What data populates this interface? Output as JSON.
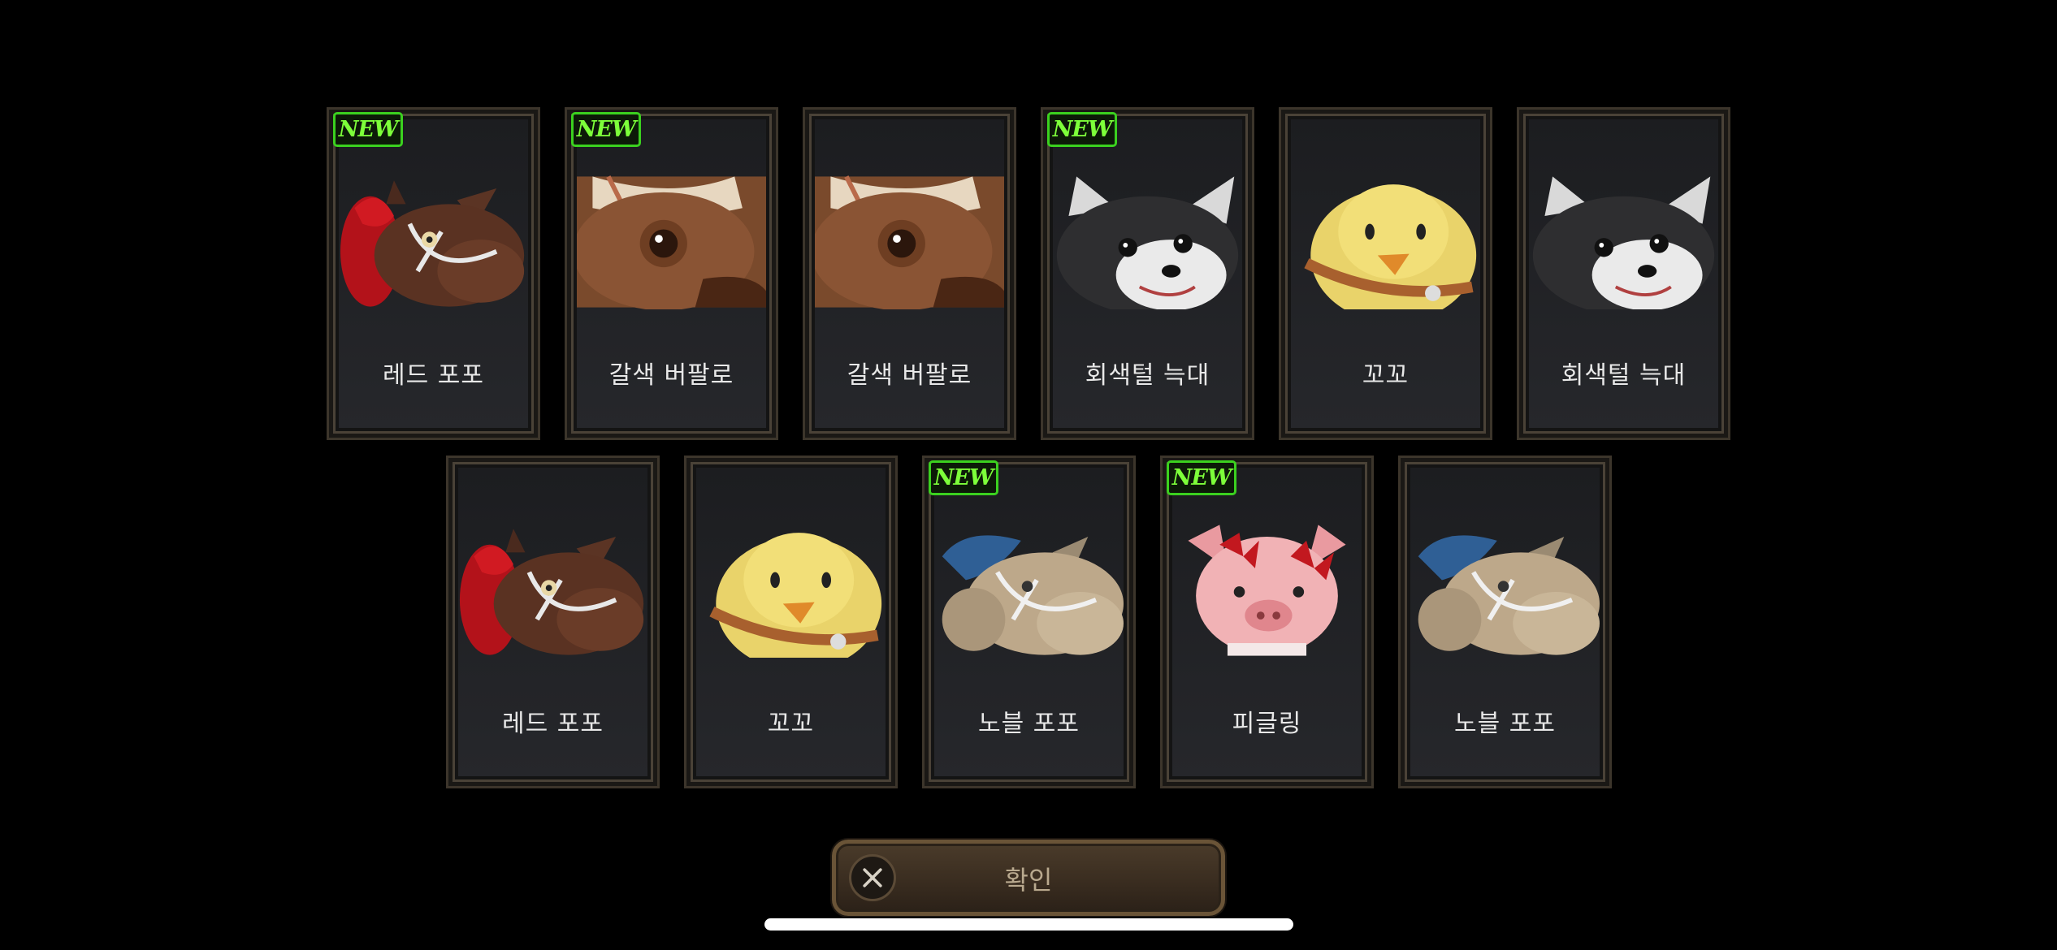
{
  "cards_row1": [
    {
      "name": "레드 포포",
      "new_badge": "NEW",
      "icon": "red-popo-horse-icon",
      "new": true
    },
    {
      "name": "갈색 버팔로",
      "new_badge": "NEW",
      "icon": "brown-buffalo-icon",
      "new": true
    },
    {
      "name": "갈색 버팔로",
      "new_badge": "",
      "icon": "brown-buffalo-icon",
      "new": false
    },
    {
      "name": "회색털 늑대",
      "new_badge": "NEW",
      "icon": "gray-wolf-icon",
      "new": true
    },
    {
      "name": "꼬꼬",
      "new_badge": "",
      "icon": "yellow-chick-icon",
      "new": false
    },
    {
      "name": "회색털 늑대",
      "new_badge": "",
      "icon": "gray-wolf-icon",
      "new": false
    }
  ],
  "cards_row2": [
    {
      "name": "레드 포포",
      "new_badge": "",
      "icon": "red-popo-horse-icon",
      "new": false
    },
    {
      "name": "꼬꼬",
      "new_badge": "",
      "icon": "yellow-chick-icon",
      "new": false
    },
    {
      "name": "노블 포포",
      "new_badge": "NEW",
      "icon": "noble-popo-horse-icon",
      "new": true
    },
    {
      "name": "피글링",
      "new_badge": "NEW",
      "icon": "pigling-icon",
      "new": true
    },
    {
      "name": "노블 포포",
      "new_badge": "",
      "icon": "noble-popo-horse-icon",
      "new": false
    }
  ],
  "confirm_button": {
    "label": "확인",
    "icon": "close-x-icon"
  },
  "colors": {
    "new_badge": "#3bd11f",
    "background": "#000000",
    "button": "#3a2d20"
  }
}
